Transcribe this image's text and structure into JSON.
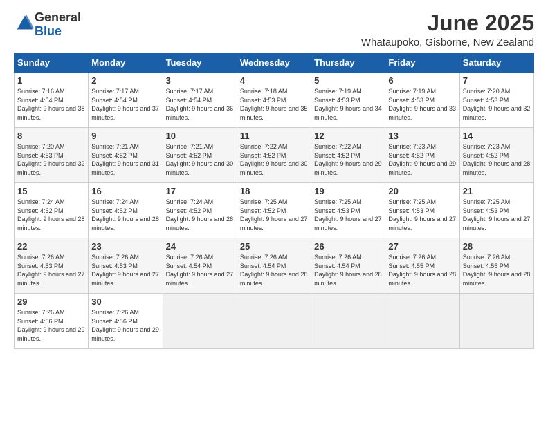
{
  "logo": {
    "line1": "General",
    "line2": "Blue"
  },
  "title": "June 2025",
  "subtitle": "Whataupoko, Gisborne, New Zealand",
  "header_days": [
    "Sunday",
    "Monday",
    "Tuesday",
    "Wednesday",
    "Thursday",
    "Friday",
    "Saturday"
  ],
  "weeks": [
    [
      {
        "day": "1",
        "sunrise": "7:16 AM",
        "sunset": "4:54 PM",
        "daylight": "9 hours and 38 minutes."
      },
      {
        "day": "2",
        "sunrise": "7:17 AM",
        "sunset": "4:54 PM",
        "daylight": "9 hours and 37 minutes."
      },
      {
        "day": "3",
        "sunrise": "7:17 AM",
        "sunset": "4:54 PM",
        "daylight": "9 hours and 36 minutes."
      },
      {
        "day": "4",
        "sunrise": "7:18 AM",
        "sunset": "4:53 PM",
        "daylight": "9 hours and 35 minutes."
      },
      {
        "day": "5",
        "sunrise": "7:19 AM",
        "sunset": "4:53 PM",
        "daylight": "9 hours and 34 minutes."
      },
      {
        "day": "6",
        "sunrise": "7:19 AM",
        "sunset": "4:53 PM",
        "daylight": "9 hours and 33 minutes."
      },
      {
        "day": "7",
        "sunrise": "7:20 AM",
        "sunset": "4:53 PM",
        "daylight": "9 hours and 32 minutes."
      }
    ],
    [
      {
        "day": "8",
        "sunrise": "7:20 AM",
        "sunset": "4:53 PM",
        "daylight": "9 hours and 32 minutes."
      },
      {
        "day": "9",
        "sunrise": "7:21 AM",
        "sunset": "4:52 PM",
        "daylight": "9 hours and 31 minutes."
      },
      {
        "day": "10",
        "sunrise": "7:21 AM",
        "sunset": "4:52 PM",
        "daylight": "9 hours and 30 minutes."
      },
      {
        "day": "11",
        "sunrise": "7:22 AM",
        "sunset": "4:52 PM",
        "daylight": "9 hours and 30 minutes."
      },
      {
        "day": "12",
        "sunrise": "7:22 AM",
        "sunset": "4:52 PM",
        "daylight": "9 hours and 29 minutes."
      },
      {
        "day": "13",
        "sunrise": "7:23 AM",
        "sunset": "4:52 PM",
        "daylight": "9 hours and 29 minutes."
      },
      {
        "day": "14",
        "sunrise": "7:23 AM",
        "sunset": "4:52 PM",
        "daylight": "9 hours and 28 minutes."
      }
    ],
    [
      {
        "day": "15",
        "sunrise": "7:24 AM",
        "sunset": "4:52 PM",
        "daylight": "9 hours and 28 minutes."
      },
      {
        "day": "16",
        "sunrise": "7:24 AM",
        "sunset": "4:52 PM",
        "daylight": "9 hours and 28 minutes."
      },
      {
        "day": "17",
        "sunrise": "7:24 AM",
        "sunset": "4:52 PM",
        "daylight": "9 hours and 28 minutes."
      },
      {
        "day": "18",
        "sunrise": "7:25 AM",
        "sunset": "4:52 PM",
        "daylight": "9 hours and 27 minutes."
      },
      {
        "day": "19",
        "sunrise": "7:25 AM",
        "sunset": "4:53 PM",
        "daylight": "9 hours and 27 minutes."
      },
      {
        "day": "20",
        "sunrise": "7:25 AM",
        "sunset": "4:53 PM",
        "daylight": "9 hours and 27 minutes."
      },
      {
        "day": "21",
        "sunrise": "7:25 AM",
        "sunset": "4:53 PM",
        "daylight": "9 hours and 27 minutes."
      }
    ],
    [
      {
        "day": "22",
        "sunrise": "7:26 AM",
        "sunset": "4:53 PM",
        "daylight": "9 hours and 27 minutes."
      },
      {
        "day": "23",
        "sunrise": "7:26 AM",
        "sunset": "4:53 PM",
        "daylight": "9 hours and 27 minutes."
      },
      {
        "day": "24",
        "sunrise": "7:26 AM",
        "sunset": "4:54 PM",
        "daylight": "9 hours and 27 minutes."
      },
      {
        "day": "25",
        "sunrise": "7:26 AM",
        "sunset": "4:54 PM",
        "daylight": "9 hours and 28 minutes."
      },
      {
        "day": "26",
        "sunrise": "7:26 AM",
        "sunset": "4:54 PM",
        "daylight": "9 hours and 28 minutes."
      },
      {
        "day": "27",
        "sunrise": "7:26 AM",
        "sunset": "4:55 PM",
        "daylight": "9 hours and 28 minutes."
      },
      {
        "day": "28",
        "sunrise": "7:26 AM",
        "sunset": "4:55 PM",
        "daylight": "9 hours and 28 minutes."
      }
    ],
    [
      {
        "day": "29",
        "sunrise": "7:26 AM",
        "sunset": "4:56 PM",
        "daylight": "9 hours and 29 minutes."
      },
      {
        "day": "30",
        "sunrise": "7:26 AM",
        "sunset": "4:56 PM",
        "daylight": "9 hours and 29 minutes."
      },
      null,
      null,
      null,
      null,
      null
    ]
  ],
  "labels": {
    "sunrise": "Sunrise:",
    "sunset": "Sunset:",
    "daylight": "Daylight:"
  }
}
